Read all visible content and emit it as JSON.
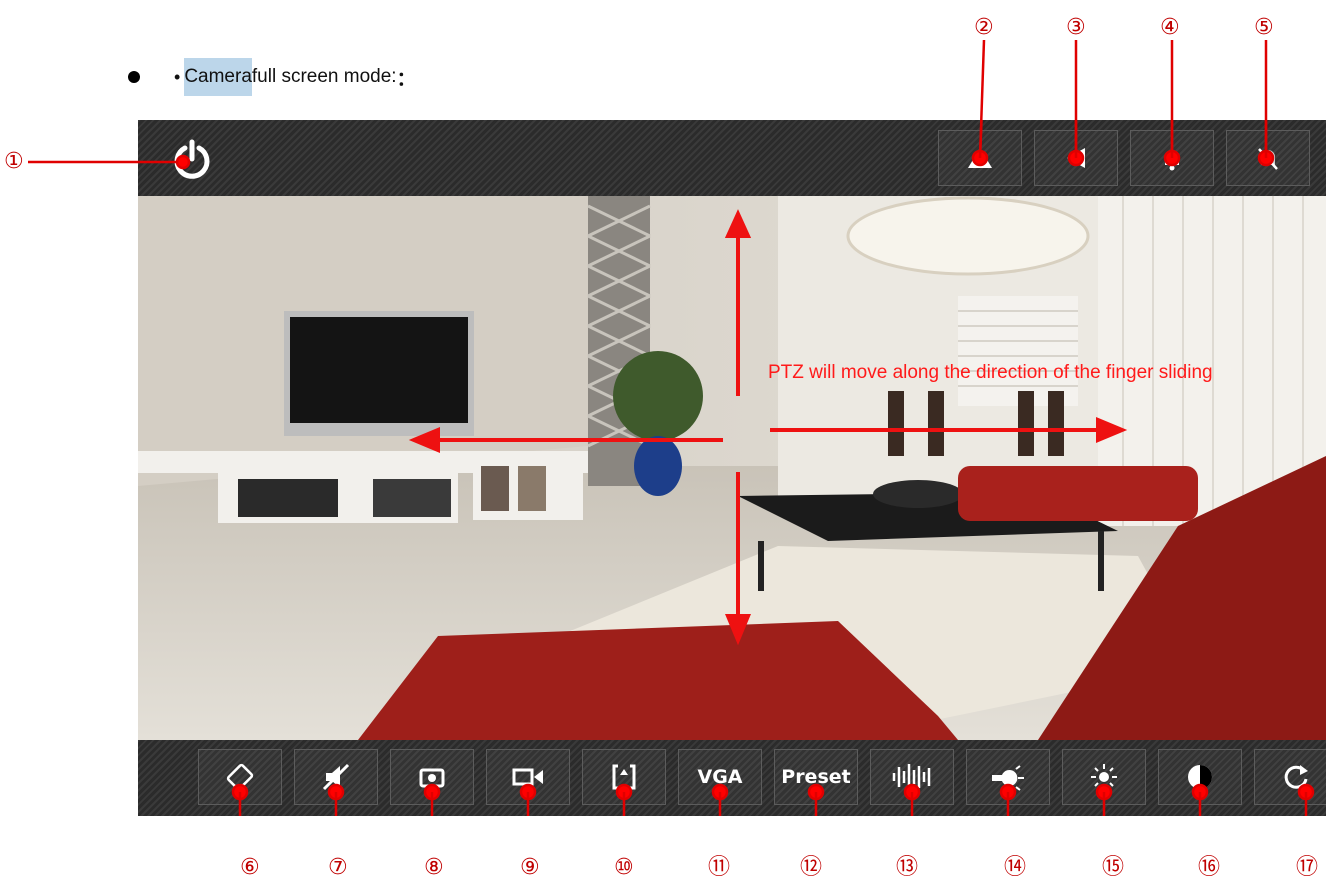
{
  "heading": {
    "bullet_dot": "•",
    "highlight": "Camera",
    "rest": " full screen mode:",
    "colon": "："
  },
  "top_buttons": [
    {
      "id": "power",
      "icon": "power-icon",
      "callout": "①"
    },
    {
      "id": "btn2",
      "icon": "triangle-up-icon",
      "callout": "②"
    },
    {
      "id": "btn3",
      "icon": "triangle-left-icon",
      "callout": "③"
    },
    {
      "id": "btn4",
      "icon": "bell-icon",
      "callout": "④"
    },
    {
      "id": "btn5",
      "icon": "alarm-off-icon",
      "callout": "⑤"
    }
  ],
  "ptz_note": "PTZ will move along the direction of the finger sliding",
  "bottom_buttons": [
    {
      "icon": "rotate-screen-icon",
      "label": "",
      "callout": "⑥"
    },
    {
      "icon": "speaker-mute-icon",
      "label": "",
      "callout": "⑦"
    },
    {
      "icon": "snapshot-camera-icon",
      "label": "",
      "callout": "⑧"
    },
    {
      "icon": "video-record-icon",
      "label": "",
      "callout": "⑨"
    },
    {
      "icon": "flip-icon",
      "label": "",
      "callout": "⑩"
    },
    {
      "icon": "",
      "label": "VGA",
      "callout": "⑪"
    },
    {
      "icon": "",
      "label": "Preset",
      "callout": "⑫"
    },
    {
      "icon": "audio-wave-icon",
      "label": "",
      "callout": "⑬"
    },
    {
      "icon": "light-bulb-icon",
      "label": "",
      "callout": "⑭"
    },
    {
      "icon": "brightness-icon",
      "label": "",
      "callout": "⑮"
    },
    {
      "icon": "contrast-icon",
      "label": "",
      "callout": "⑯"
    },
    {
      "icon": "refresh-icon",
      "label": "",
      "callout": "⑰"
    }
  ],
  "colors": {
    "annotation": "#e00000",
    "bar": "#2f2f2f",
    "highlight": "#bcd6ea"
  }
}
